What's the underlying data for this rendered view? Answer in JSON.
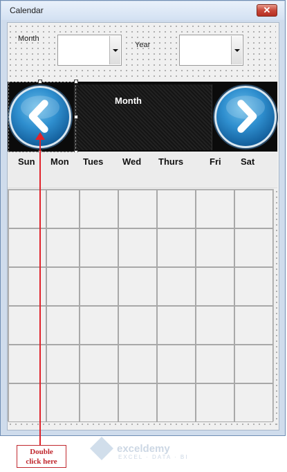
{
  "window": {
    "title": "Calendar",
    "close_glyph": "✕"
  },
  "form": {
    "month_label": "Month",
    "year_label": "Year",
    "month_value": "",
    "year_value": ""
  },
  "banner": {
    "title": "Month",
    "prev_icon": "chevron-left-icon",
    "next_icon": "chevron-right-icon"
  },
  "days": [
    "Sun",
    "Mon",
    "Tues",
    "Wed",
    "Thurs",
    "Fri",
    "Sat"
  ],
  "calendar": {
    "rows": 6,
    "cols": 7
  },
  "annotation": {
    "line1": "Double",
    "line2": "click here"
  },
  "watermark": {
    "name": "exceldemy",
    "tagline": "EXCEL · DATA · BI"
  },
  "colors": {
    "annotation_red": "#e0222a",
    "nav_blue": "#2f8fcf",
    "banner_dark": "#0b0b0b"
  }
}
